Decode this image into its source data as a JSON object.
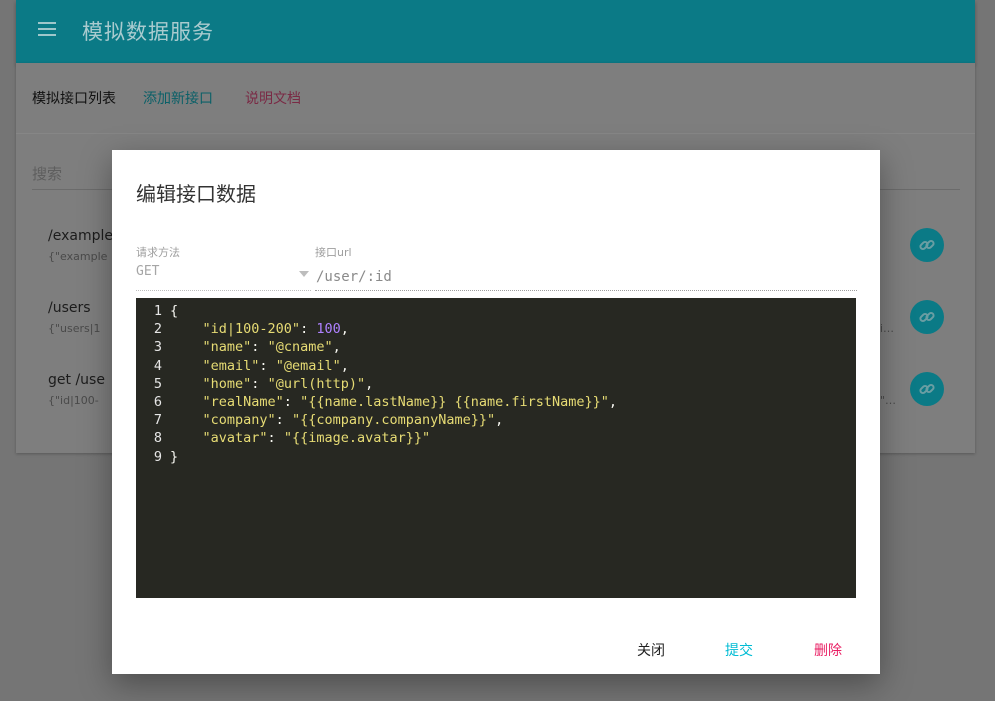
{
  "app": {
    "title": "模拟数据服务",
    "menu_icon": "menu-icon"
  },
  "tabs": [
    {
      "label": "模拟接口列表"
    },
    {
      "label": "添加新接口"
    },
    {
      "label": "说明文档"
    }
  ],
  "search": {
    "placeholder": "搜索"
  },
  "rows": [
    {
      "path": "/example",
      "body": "{\"example"
    },
    {
      "path": "/users",
      "body": "{\"users|1",
      "tail": "i…"
    },
    {
      "path": "get /use",
      "body": "{\"id|100-",
      "tail": "\"…"
    }
  ],
  "dialog": {
    "title": "编辑接口数据",
    "method_label": "请求方法",
    "method_value": "GET",
    "url_label": "接口url",
    "url_value": "/user/:id",
    "code_lines": [
      "{",
      "    \"id|100-200\": 100,",
      "    \"name\": \"@cname\",",
      "    \"email\": \"@email\",",
      "    \"home\": \"@url(http)\",",
      "    \"realName\": \"{{name.lastName}} {{name.firstName}}\",",
      "    \"company\": \"{{company.companyName}}\",",
      "    \"avatar\": \"{{image.avatar}}\"",
      "}"
    ],
    "buttons": {
      "close": "关闭",
      "submit": "提交",
      "delete": "删除"
    }
  },
  "colors": {
    "primary": "#00bcd4",
    "accent": "#e91e63",
    "editor_bg": "#272822"
  }
}
